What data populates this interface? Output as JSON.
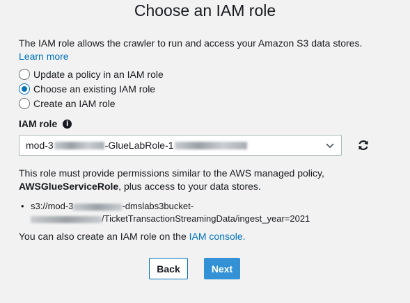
{
  "page": {
    "title": "Choose an IAM role"
  },
  "description": {
    "text": "The IAM role allows the crawler to run and access your Amazon S3 data stores.",
    "learn_more": "Learn more"
  },
  "options": [
    {
      "label": "Update a policy in an IAM role",
      "selected": false
    },
    {
      "label": "Choose an existing IAM role",
      "selected": true
    },
    {
      "label": "Create an IAM role",
      "selected": false
    }
  ],
  "iam_role": {
    "label": "IAM role",
    "value_prefix": "mod-3",
    "value_middle": "-GlueLabRole-1"
  },
  "permissions": {
    "line1": "This role must provide permissions similar to the AWS managed policy,",
    "policy": "AWSGlueServiceRole",
    "line2_rest": ", plus access to your data stores."
  },
  "data_store": {
    "part1": "s3://mod-3",
    "part2": "-dmslabs3bucket-",
    "part3": "/TicketTransactionStreamingData/ingest_year=2021"
  },
  "console": {
    "text": "You can also create an IAM role on the ",
    "link": "IAM console."
  },
  "buttons": {
    "back": "Back",
    "next": "Next"
  },
  "colors": {
    "accent": "#0073bb",
    "primary_button": "#3392d6",
    "background": "#f2f2f2"
  }
}
